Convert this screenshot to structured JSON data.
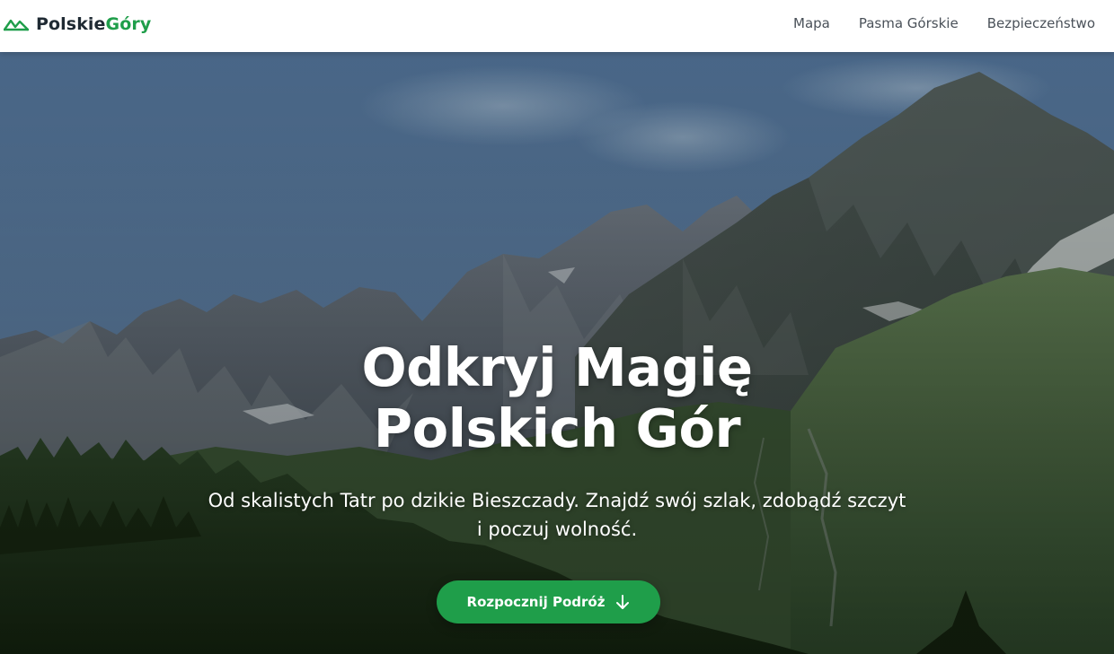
{
  "header": {
    "logo": {
      "icon": "mountain-icon",
      "text_primary": "Polskie",
      "text_accent": "Góry"
    },
    "nav": [
      {
        "label": "Mapa"
      },
      {
        "label": "Pasma Górskie"
      },
      {
        "label": "Bezpieczeństwo"
      }
    ]
  },
  "hero": {
    "title_line1": "Odkryj Magię",
    "title_line2": "Polskich Gór",
    "subtitle_line1": "Od skalistych Tatr po dzikie Bieszczady. Znajdź swój szlak, zdobądź szczyt",
    "subtitle_line2": "i poczuj wolność.",
    "cta": {
      "label": "Rozpocznij Podróż",
      "icon": "arrow-down-icon"
    },
    "background_image": "mountain-landscape"
  },
  "colors": {
    "brand_green": "#1f9e4a",
    "logo_dark": "#1f2a33",
    "nav_text": "#4a5159",
    "header_bg": "#ffffff"
  }
}
